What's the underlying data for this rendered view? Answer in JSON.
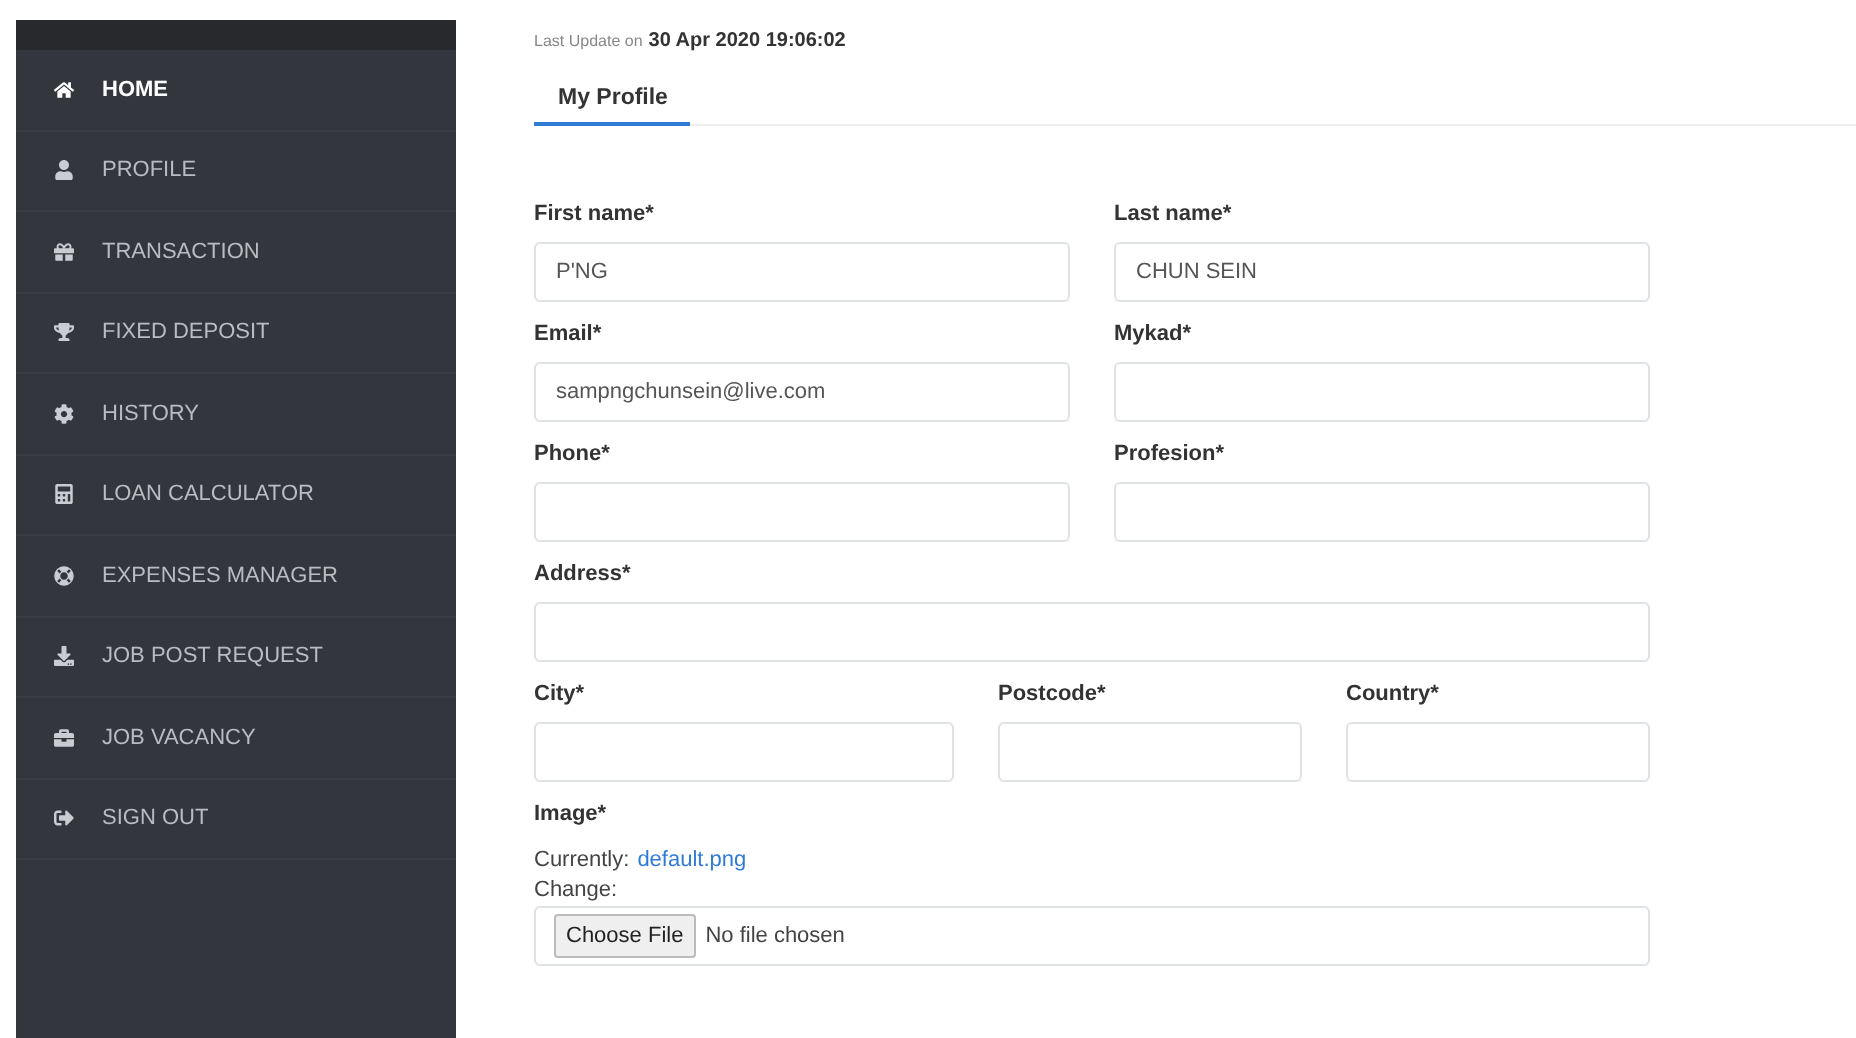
{
  "sidebar": {
    "items": [
      {
        "label": "HOME",
        "selected": true
      },
      {
        "label": "PROFILE",
        "selected": false
      },
      {
        "label": "TRANSACTION",
        "selected": false
      },
      {
        "label": "FIXED DEPOSIT",
        "selected": false
      },
      {
        "label": "HISTORY",
        "selected": false
      },
      {
        "label": "LOAN CALCULATOR",
        "selected": false
      },
      {
        "label": "EXPENSES MANAGER",
        "selected": false
      },
      {
        "label": "JOB POST REQUEST",
        "selected": false
      },
      {
        "label": "JOB VACANCY",
        "selected": false
      },
      {
        "label": "SIGN OUT",
        "selected": false
      }
    ]
  },
  "last_update": {
    "label": "Last Update on",
    "value": "30 Apr 2020 19:06:02"
  },
  "tabs": [
    {
      "label": "My Profile",
      "selected": true
    }
  ],
  "form": {
    "rows": [
      [
        {
          "label": "First name*",
          "value": "P'NG"
        },
        {
          "label": "Last name*",
          "value": "CHUN SEIN"
        }
      ],
      [
        {
          "label": "Email*",
          "value": "sampngchunsein@live.com"
        },
        {
          "label": "Mykad*"
        }
      ],
      [
        {
          "label": "Phone*"
        },
        {
          "label": "Profesion*"
        }
      ],
      [
        {
          "label": "Address*"
        }
      ],
      [
        {
          "label": "City*"
        },
        {
          "label": "Postcode*"
        },
        {
          "label": "Country*"
        }
      ]
    ]
  },
  "image": {
    "label": "Image*",
    "currently_label": "Currently:",
    "currently_link": "default.png",
    "change_label": "Change:",
    "button": "Choose File",
    "status": "No file chosen"
  }
}
